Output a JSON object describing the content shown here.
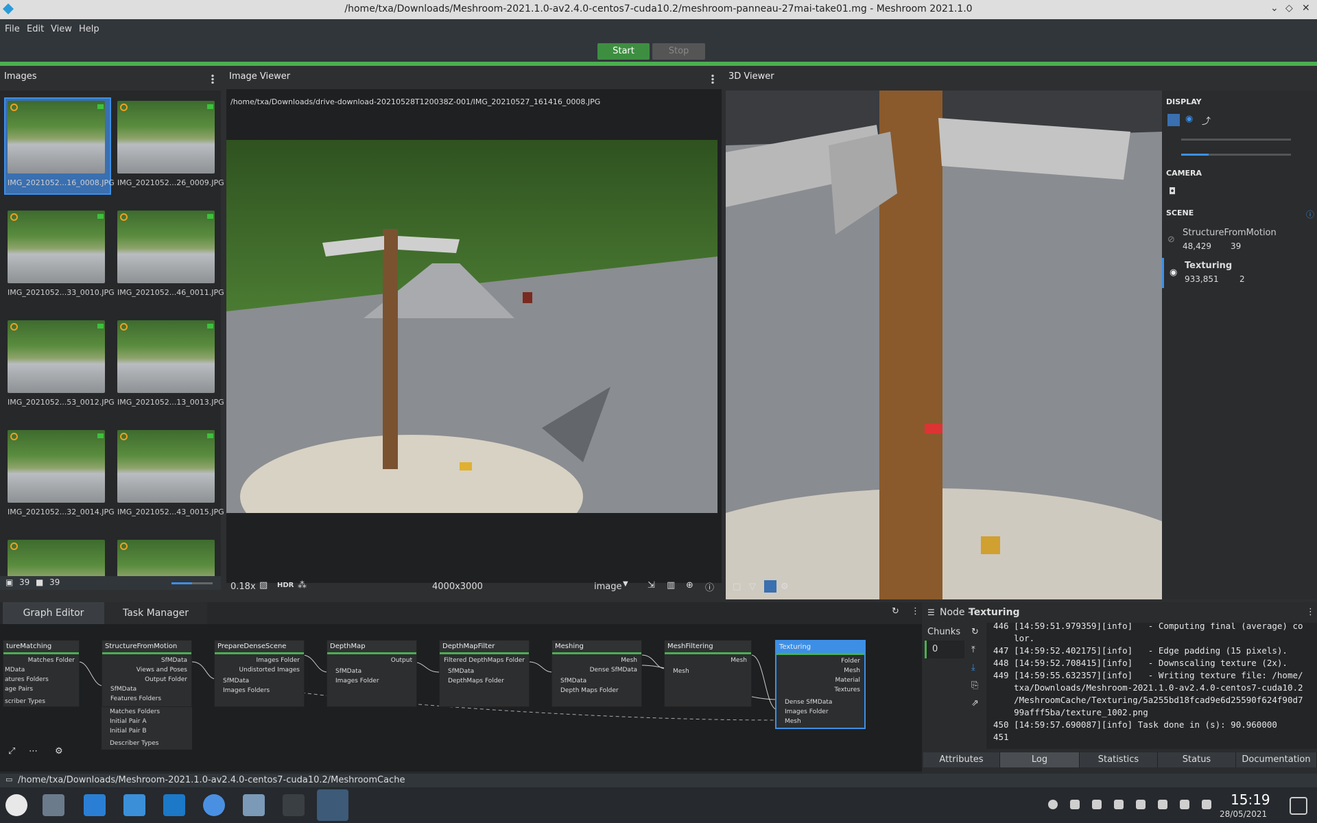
{
  "window": {
    "title": "/home/txa/Downloads/Meshroom-2021.1.0-av2.4.0-centos7-cuda10.2/meshroom-panneau-27mai-take01.mg - Meshroom 2021.1.0"
  },
  "menu": [
    "File",
    "Edit",
    "View",
    "Help"
  ],
  "toolbar": {
    "start": "Start",
    "stop": "Stop"
  },
  "images_panel": {
    "title": "Images",
    "count_images": "39",
    "count_cameras": "39",
    "thumbs": [
      "IMG_2021052...16_0008.JPG",
      "IMG_2021052...26_0009.JPG",
      "IMG_2021052...33_0010.JPG",
      "IMG_2021052...46_0011.JPG",
      "IMG_2021052...53_0012.JPG",
      "IMG_2021052...13_0013.JPG",
      "IMG_2021052...32_0014.JPG",
      "IMG_2021052...43_0015.JPG"
    ]
  },
  "image_viewer": {
    "title": "Image Viewer",
    "path": "/home/txa/Downloads/drive-download-20210528T120038Z-001/IMG_20210527_161416_0008.JPG",
    "zoom": "0.18x",
    "hdr": "HDR",
    "resolution": "4000x3000",
    "mode": "image"
  },
  "viewer3d": {
    "title": "3D Viewer"
  },
  "side": {
    "display": "DISPLAY",
    "camera": "CAMERA",
    "scene": "SCENE",
    "items": [
      {
        "name": "StructureFromMotion",
        "stat1": "48,429",
        "stat2": "39"
      },
      {
        "name": "Texturing",
        "stat1": "933,851",
        "stat2": "2"
      }
    ]
  },
  "tabs": {
    "graph": "Graph Editor",
    "task": "Task Manager"
  },
  "nodes": [
    {
      "name": "tureMatching",
      "outs": [
        "Matches Folder"
      ],
      "ins": [
        "MData",
        "atures Folders",
        "age Pairs",
        "scriber Types"
      ]
    },
    {
      "name": "StructureFromMotion",
      "outs": [
        "SfMData",
        "Views and Poses",
        "Output Folder"
      ],
      "ins": [
        "SfMData",
        "Features Folders",
        "Matches Folders",
        "Initial Pair A",
        "Initial Pair B",
        "Describer Types"
      ]
    },
    {
      "name": "PrepareDenseScene",
      "outs": [
        "Images Folder",
        "Undistorted Images"
      ],
      "ins": [
        "SfMData",
        "Images Folders"
      ]
    },
    {
      "name": "DepthMap",
      "outs": [
        "Output"
      ],
      "ins": [
        "SfMData",
        "Images Folder"
      ]
    },
    {
      "name": "DepthMapFilter",
      "outs": [
        "Filtered DepthMaps Folder"
      ],
      "ins": [
        "SfMData",
        "DepthMaps Folder"
      ]
    },
    {
      "name": "Meshing",
      "outs": [
        "Mesh",
        "Dense SfMData"
      ],
      "ins": [
        "SfMData",
        "Depth Maps Folder"
      ]
    },
    {
      "name": "MeshFiltering",
      "outs": [
        "Mesh"
      ],
      "ins": [
        "Mesh"
      ]
    },
    {
      "name": "Texturing",
      "outs": [
        "Folder",
        "Mesh",
        "Material",
        "Textures"
      ],
      "ins": [
        "Dense SfMData",
        "Images Folder",
        "Mesh"
      ]
    }
  ],
  "node_panel": {
    "prefix": "Node - ",
    "name": "Texturing",
    "chunks_label": "Chunks",
    "chunk": "0",
    "log": [
      "446 [14:59:51.979359][info]   - Computing final (average) co",
      "    lor.",
      "447 [14:59:52.402175][info]   - Edge padding (15 pixels).",
      "448 [14:59:52.708415][info]   - Downscaling texture (2x).",
      "449 [14:59:55.632357][info]   - Writing texture file: /home/",
      "    txa/Downloads/Meshroom-2021.1.0-av2.4.0-centos7-cuda10.2",
      "    /MeshroomCache/Texturing/5a255bd18fcad9e6d25590f624f90d7",
      "    99afff5ba/texture_1002.png",
      "450 [14:59:57.690087][info] Task done in (s): 90.960000",
      "451"
    ],
    "tabs": [
      "Attributes",
      "Log",
      "Statistics",
      "Status",
      "Documentation"
    ]
  },
  "status": {
    "path": "/home/txa/Downloads/Meshroom-2021.1.0-av2.4.0-centos7-cuda10.2/MeshroomCache"
  },
  "taskbar": {
    "time": "15:19",
    "date": "28/05/2021"
  }
}
